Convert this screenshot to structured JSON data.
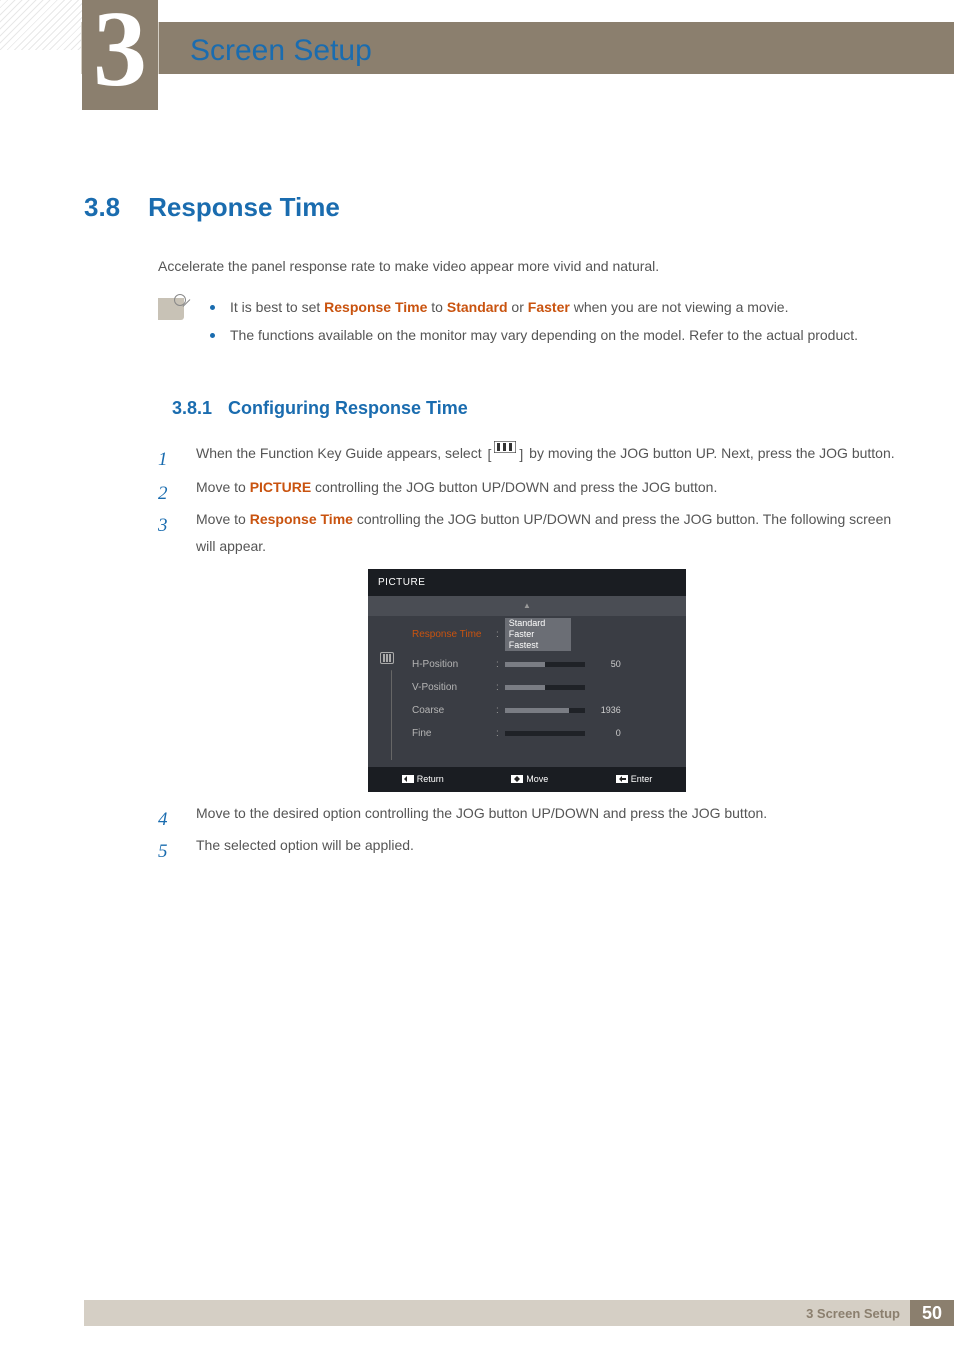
{
  "chapter": {
    "number": "3",
    "title": "Screen Setup"
  },
  "section": {
    "number": "3.8",
    "title": "Response Time"
  },
  "intro": "Accelerate the panel response rate to make video appear more vivid and natural.",
  "notes": {
    "item1_a": "It is best to set ",
    "item1_b": " to ",
    "item1_c": " or ",
    "item1_d": " when you are not viewing a movie.",
    "h1": "Response Time",
    "h2": "Standard",
    "h3": "Faster",
    "item2": "The functions available on the monitor may vary depending on the model. Refer to the actual product."
  },
  "subsection": {
    "number": "3.8.1",
    "title": "Configuring Response Time"
  },
  "steps": {
    "s1a": "When the Function Key Guide appears, select ",
    "s1b": " by moving the JOG button UP. Next, press the JOG button.",
    "s2a": "Move to ",
    "s2h": "PICTURE",
    "s2b": " controlling the JOG button UP/DOWN and press the JOG button.",
    "s3a": "Move to  ",
    "s3h": "Response Time",
    "s3b": " controlling the JOG button UP/DOWN and press the JOG button. The following screen will appear.",
    "s4": "Move to the desired option controlling the JOG button UP/DOWN and press the JOG button.",
    "s5": "The selected option will be applied."
  },
  "osd": {
    "title": "PICTURE",
    "rows": {
      "r0": "Response Time",
      "r1": "H-Position",
      "r2": "V-Position",
      "r3": "Coarse",
      "r4": "Fine"
    },
    "dropdown": {
      "o0": "Standard",
      "o1": "Faster",
      "o2": "Fastest"
    },
    "values": {
      "hpos": "50",
      "coarse": "1936",
      "fine": "0"
    },
    "footer": {
      "return": "Return",
      "move": "Move",
      "enter": "Enter"
    }
  },
  "footer": {
    "chapter": "3 Screen Setup",
    "page": "50"
  }
}
